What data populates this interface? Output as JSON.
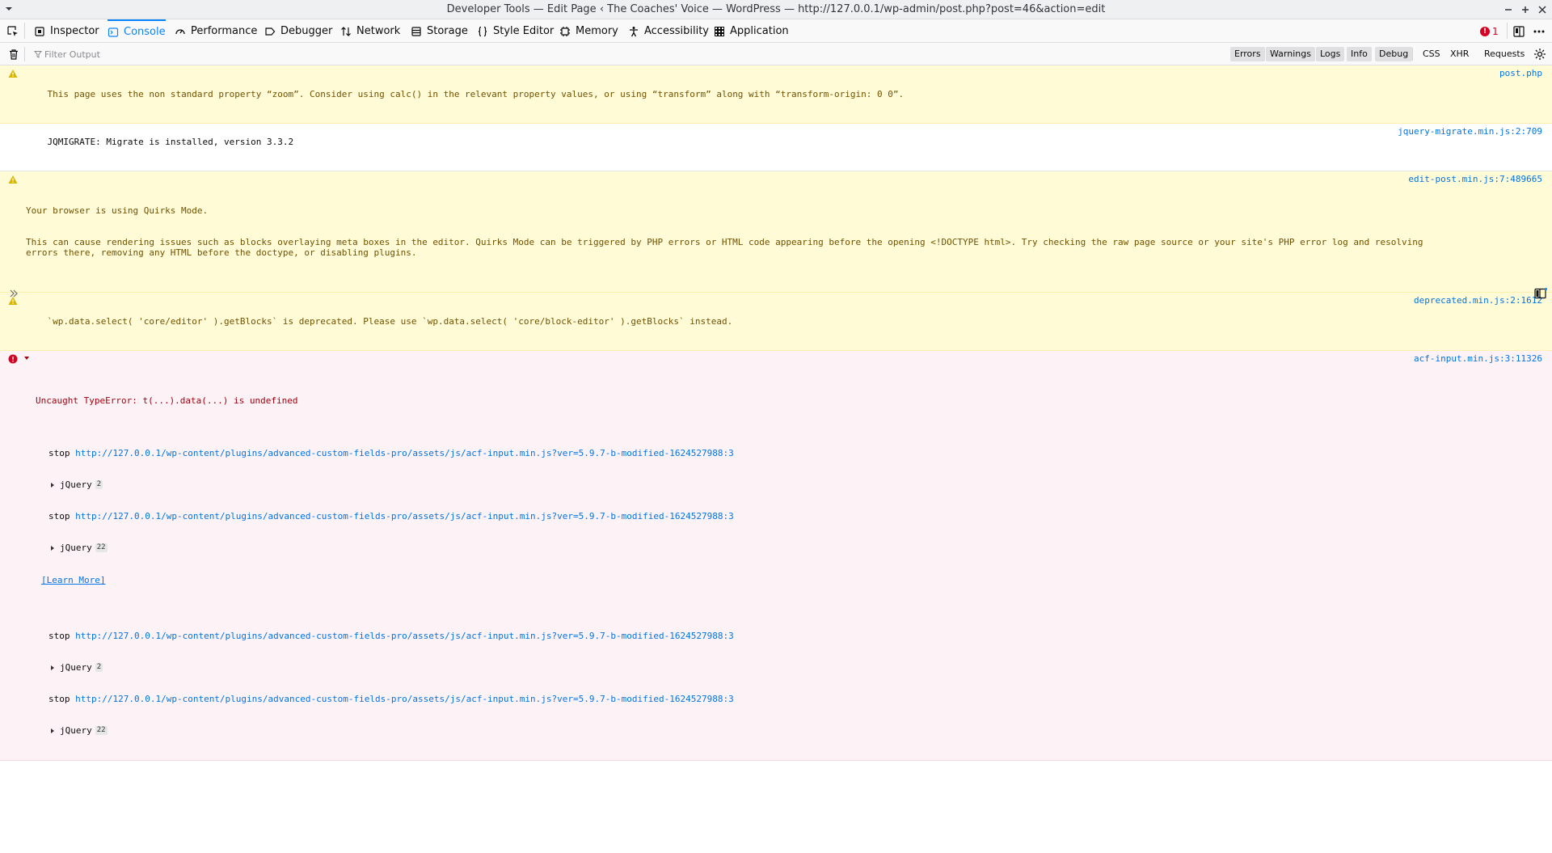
{
  "window": {
    "title": "Developer Tools — Edit Page ‹ The Coaches' Voice — WordPress — http://127.0.0.1/wp-admin/post.php?post=46&action=edit"
  },
  "toolbar": {
    "tabs": [
      {
        "label": "Inspector",
        "icon": "inspector-icon"
      },
      {
        "label": "Console",
        "icon": "console-icon",
        "active": true
      },
      {
        "label": "Performance",
        "icon": "performance-icon"
      },
      {
        "label": "Debugger",
        "icon": "debugger-icon"
      },
      {
        "label": "Network",
        "icon": "network-icon"
      },
      {
        "label": "Storage",
        "icon": "storage-icon"
      },
      {
        "label": "Style Editor",
        "icon": "style-editor-icon"
      },
      {
        "label": "Memory",
        "icon": "memory-icon"
      },
      {
        "label": "Accessibility",
        "icon": "accessibility-icon"
      },
      {
        "label": "Application",
        "icon": "application-icon"
      }
    ],
    "error_count": "1"
  },
  "filter": {
    "placeholder": "Filter Output",
    "buttons": {
      "errors": "Errors",
      "warnings": "Warnings",
      "logs": "Logs",
      "info": "Info",
      "debug": "Debug",
      "css": "CSS",
      "xhr": "XHR",
      "requests": "Requests"
    }
  },
  "messages": {
    "zoom": {
      "text": "This page uses the non standard property “zoom”. Consider using calc() in the relevant property values, or using “transform” along with “transform-origin: 0 0”.",
      "source": "post.php"
    },
    "jqmigrate": {
      "text": "JQMIGRATE: Migrate is installed, version 3.3.2",
      "source": "jquery-migrate.min.js:2:709"
    },
    "quirks": {
      "line1": "Your browser is using Quirks Mode.",
      "line2": "This can cause rendering issues such as blocks overlaying meta boxes in the editor. Quirks Mode can be triggered by PHP errors or HTML code appearing before the opening <!DOCTYPE html>. Try checking the raw page source or your site's PHP error log and resolving errors there, removing any HTML before the doctype, or disabling plugins.",
      "source": "edit-post.min.js:7:489665"
    },
    "deprecated": {
      "text": "`wp.data.select( 'core/editor' ).getBlocks` is deprecated. Please use `wp.data.select( 'core/block-editor' ).getBlocks` instead.",
      "source": "deprecated.min.js:2:1612"
    },
    "error": {
      "text": "Uncaught TypeError: t(...).data(...) is undefined",
      "source": "acf-input.min.js:3:11326",
      "stack_fn": "stop",
      "stack_url": "http://127.0.0.1/wp-content/plugins/advanced-custom-fields-pro/assets/js/acf-input.min.js?ver=5.9.7-b-modified-1624527988:3",
      "jquery_label": "jQuery",
      "badge_2": "2",
      "badge_22": "22",
      "learn_more": "[Learn More]"
    }
  }
}
